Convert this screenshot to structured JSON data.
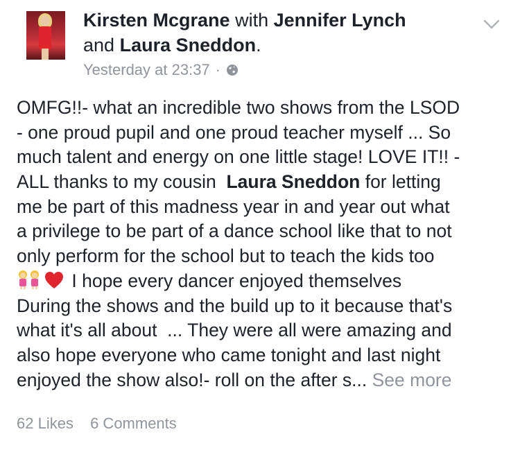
{
  "post": {
    "author": "Kirsten Mcgrane",
    "with_word": "with",
    "tag1": "Jennifer Lynch",
    "and_word": "and",
    "tag2": "Laura Sneddon",
    "period": ".",
    "timestamp": "Yesterday at 23:37",
    "separator": "·",
    "privacy_icon": "globe-icon",
    "menu_icon": "chevron-down-icon",
    "body_lines": [
      "OMFG!!- what an incredible two shows from the LSOD",
      "- one proud pupil and one proud teacher myself ... So",
      "much talent and energy on one little stage! LOVE IT!! -",
      {
        "pre": "ALL thanks to my cousin  ",
        "mention": "Laura Sneddon",
        "post": " for letting"
      },
      "me be part of this madness year in and year out what",
      "a privilege to be part of a dance school like that to not",
      "only perform for the school but to teach the kids too",
      {
        "emojis": [
          "two-women-emoji",
          "red-heart-emoji"
        ],
        "text": " I hope every dancer enjoyed themselves"
      },
      "During the shows and the build up to it because that's",
      "what it's all about  ... They were all were amazing and",
      "also hope everyone who came tonight and last night",
      {
        "text": "enjoyed the show also!- roll on the after s... ",
        "link": "See more"
      }
    ],
    "likes": "62 Likes",
    "comments": "6 Comments"
  },
  "colors": {
    "text": "#1d2129",
    "meta": "#90949c",
    "heart": "#e0262d"
  }
}
